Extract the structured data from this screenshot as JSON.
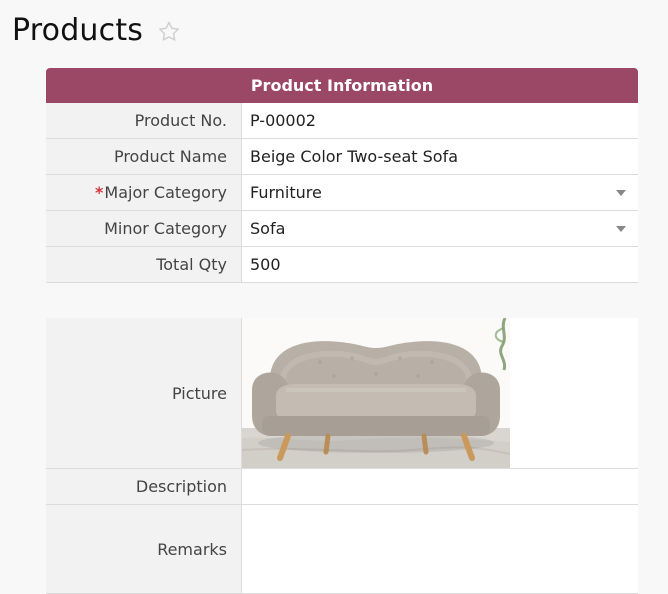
{
  "page": {
    "title": "Products"
  },
  "product_information": {
    "section_title": "Product Information",
    "fields": {
      "product_no": {
        "label": "Product No.",
        "value": "P-00002"
      },
      "product_name": {
        "label": "Product Name",
        "value": "Beige Color Two-seat Sofa"
      },
      "major_category": {
        "required_mark": "*",
        "label": "Major Category",
        "value": "Furniture"
      },
      "minor_category": {
        "label": "Minor Category",
        "value": "Sofa"
      },
      "total_qty": {
        "label": "Total Qty",
        "value": "500"
      }
    }
  },
  "details": {
    "picture": {
      "label": "Picture",
      "alt": "Beige Color Two-seat Sofa"
    },
    "description": {
      "label": "Description",
      "value": ""
    },
    "remarks": {
      "label": "Remarks",
      "value": ""
    }
  },
  "icons": {
    "favorite": "star-outline-icon",
    "dropdown": "caret-down-icon"
  },
  "colors": {
    "section_header_bg": "#9b4766",
    "required_marker": "#d03a3a"
  }
}
